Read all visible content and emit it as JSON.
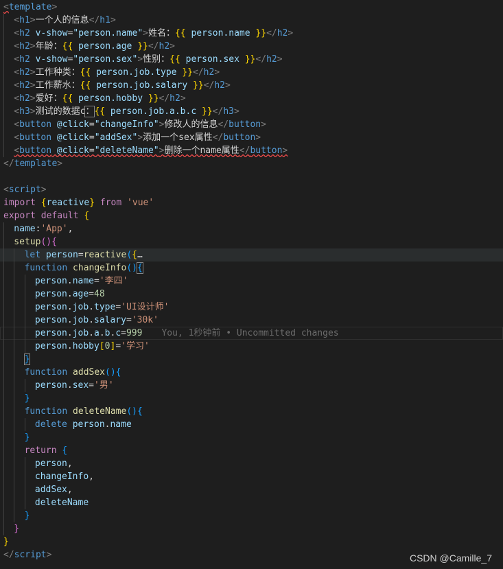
{
  "colors": {
    "background": "#1e1e1e",
    "tag_bracket": "#808080",
    "tag_name": "#569cd6",
    "attribute": "#9cdcfe",
    "string": "#ce9178",
    "keyword": "#c586c0",
    "function": "#dcdcaa",
    "number": "#b5cea8",
    "text": "#d4d4d4",
    "brace_gold": "#ffd700",
    "brace_pink": "#da70d6",
    "brace_blue": "#179fff",
    "ghost": "#6b6b6b"
  },
  "editor": {
    "lines": [
      {
        "indent": 0,
        "tokens": [
          [
            "<",
            "b"
          ],
          [
            "template",
            "t"
          ],
          [
            ">",
            "b"
          ]
        ],
        "squiggle_first": true
      },
      {
        "indent": 1,
        "tokens": [
          [
            "<",
            "b"
          ],
          [
            "h1",
            "t"
          ],
          [
            ">",
            "b"
          ],
          [
            "一个人的信息",
            "x"
          ],
          [
            "</",
            "b"
          ],
          [
            "h1",
            "t"
          ],
          [
            ">",
            "b"
          ]
        ]
      },
      {
        "indent": 1,
        "tokens": [
          [
            "<",
            "b"
          ],
          [
            "h2",
            "t"
          ],
          [
            " v-show",
            "a"
          ],
          [
            "=",
            "x"
          ],
          [
            "\"person.name\"",
            "a"
          ],
          [
            ">",
            "b"
          ],
          [
            "姓名：",
            "x"
          ],
          [
            "{{",
            "g"
          ],
          [
            " person.name ",
            "a"
          ],
          [
            "}}",
            "g"
          ],
          [
            "</",
            "b"
          ],
          [
            "h2",
            "t"
          ],
          [
            ">",
            "b"
          ]
        ]
      },
      {
        "indent": 1,
        "tokens": [
          [
            "<",
            "b"
          ],
          [
            "h2",
            "t"
          ],
          [
            ">",
            "b"
          ],
          [
            "年龄：",
            "x"
          ],
          [
            "{{",
            "g"
          ],
          [
            " person.age ",
            "a"
          ],
          [
            "}}",
            "g"
          ],
          [
            "</",
            "b"
          ],
          [
            "h2",
            "t"
          ],
          [
            ">",
            "b"
          ]
        ]
      },
      {
        "indent": 1,
        "tokens": [
          [
            "<",
            "b"
          ],
          [
            "h2",
            "t"
          ],
          [
            " v-show",
            "a"
          ],
          [
            "=",
            "x"
          ],
          [
            "\"person.sex\"",
            "a"
          ],
          [
            ">",
            "b"
          ],
          [
            "性别：",
            "x"
          ],
          [
            "{{",
            "g"
          ],
          [
            " person.sex ",
            "a"
          ],
          [
            "}}",
            "g"
          ],
          [
            "</",
            "b"
          ],
          [
            "h2",
            "t"
          ],
          [
            ">",
            "b"
          ]
        ]
      },
      {
        "indent": 1,
        "tokens": [
          [
            "<",
            "b"
          ],
          [
            "h2",
            "t"
          ],
          [
            ">",
            "b"
          ],
          [
            "工作种类：",
            "x"
          ],
          [
            "{{",
            "g"
          ],
          [
            " person.job.type ",
            "a"
          ],
          [
            "}}",
            "g"
          ],
          [
            "</",
            "b"
          ],
          [
            "h2",
            "t"
          ],
          [
            ">",
            "b"
          ]
        ]
      },
      {
        "indent": 1,
        "tokens": [
          [
            "<",
            "b"
          ],
          [
            "h2",
            "t"
          ],
          [
            ">",
            "b"
          ],
          [
            "工作薪水：",
            "x"
          ],
          [
            "{{",
            "g"
          ],
          [
            " person.job.salary ",
            "a"
          ],
          [
            "}}",
            "g"
          ],
          [
            "</",
            "b"
          ],
          [
            "h2",
            "t"
          ],
          [
            ">",
            "b"
          ]
        ]
      },
      {
        "indent": 1,
        "tokens": [
          [
            "<",
            "b"
          ],
          [
            "h2",
            "t"
          ],
          [
            ">",
            "b"
          ],
          [
            "爱好：",
            "x"
          ],
          [
            "{{",
            "g"
          ],
          [
            " person.hobby ",
            "a"
          ],
          [
            "}}",
            "g"
          ],
          [
            "</",
            "b"
          ],
          [
            "h2",
            "t"
          ],
          [
            ">",
            "b"
          ]
        ]
      },
      {
        "indent": 1,
        "tokens": [
          [
            "<",
            "b"
          ],
          [
            "h3",
            "t"
          ],
          [
            ">",
            "b"
          ],
          [
            "测试的数据c",
            "x"
          ],
          [
            "：",
            "box"
          ],
          [
            "{{",
            "g"
          ],
          [
            " person.job.a.b.c ",
            "a"
          ],
          [
            "}}",
            "g"
          ],
          [
            "</",
            "b"
          ],
          [
            "h3",
            "t"
          ],
          [
            ">",
            "b"
          ]
        ]
      },
      {
        "indent": 1,
        "tokens": [
          [
            "<",
            "b"
          ],
          [
            "button",
            "t"
          ],
          [
            " @click",
            "a"
          ],
          [
            "=",
            "x"
          ],
          [
            "\"changeInfo\"",
            "a"
          ],
          [
            ">",
            "b"
          ],
          [
            "修改人的信息",
            "x"
          ],
          [
            "</",
            "b"
          ],
          [
            "button",
            "t"
          ],
          [
            ">",
            "b"
          ]
        ]
      },
      {
        "indent": 1,
        "tokens": [
          [
            "<",
            "b"
          ],
          [
            "button",
            "t"
          ],
          [
            " @click",
            "a"
          ],
          [
            "=",
            "x"
          ],
          [
            "\"addSex\"",
            "a"
          ],
          [
            ">",
            "b"
          ],
          [
            "添加一个sex属性",
            "x"
          ],
          [
            "</",
            "b"
          ],
          [
            "button",
            "t"
          ],
          [
            ">",
            "b"
          ]
        ]
      },
      {
        "indent": 1,
        "tokens": [
          [
            "<",
            "b"
          ],
          [
            "button",
            "t"
          ],
          [
            " @click",
            "a"
          ],
          [
            "=",
            "x"
          ],
          [
            "\"deleteName\"",
            "a"
          ],
          [
            ">",
            "b"
          ],
          [
            "删除一个name属性",
            "x"
          ],
          [
            "</",
            "b"
          ],
          [
            "button",
            "t"
          ],
          [
            ">",
            "b"
          ]
        ],
        "squiggle_all": true
      },
      {
        "indent": 0,
        "tokens": [
          [
            "</",
            "b"
          ],
          [
            "template",
            "t"
          ],
          [
            ">",
            "b"
          ]
        ]
      },
      {
        "indent": 0,
        "tokens": []
      },
      {
        "indent": 0,
        "tokens": [
          [
            "<",
            "b"
          ],
          [
            "script",
            "t"
          ],
          [
            ">",
            "b"
          ]
        ]
      },
      {
        "indent": 0,
        "tokens": [
          [
            "import ",
            "k"
          ],
          [
            "{",
            "g"
          ],
          [
            "reactive",
            "a"
          ],
          [
            "}",
            "g"
          ],
          [
            " from ",
            "k"
          ],
          [
            "'vue'",
            "s"
          ]
        ]
      },
      {
        "indent": 0,
        "tokens": [
          [
            "export ",
            "k"
          ],
          [
            "default ",
            "k"
          ],
          [
            "{",
            "g"
          ]
        ]
      },
      {
        "indent": 1,
        "tokens": [
          [
            "name",
            "a"
          ],
          [
            ":",
            "x"
          ],
          [
            "'App'",
            "s"
          ],
          [
            ",",
            "x"
          ]
        ]
      },
      {
        "indent": 1,
        "tokens": [
          [
            "setup",
            "f"
          ],
          [
            "()",
            "p"
          ],
          [
            "{",
            "p"
          ]
        ]
      },
      {
        "indent": 2,
        "tokens": [
          [
            "let ",
            "t"
          ],
          [
            "person",
            "a"
          ],
          [
            "=",
            "x"
          ],
          [
            "reactive",
            "f"
          ],
          [
            "(",
            "b2"
          ],
          [
            "{",
            "g"
          ],
          [
            "…",
            "x"
          ]
        ],
        "highlight": true
      },
      {
        "indent": 2,
        "tokens": [
          [
            "function ",
            "t"
          ],
          [
            "changeInfo",
            "f"
          ],
          [
            "()",
            "b2"
          ],
          [
            "{",
            "box2"
          ]
        ]
      },
      {
        "indent": 3,
        "tokens": [
          [
            "person",
            "a"
          ],
          [
            ".",
            "x"
          ],
          [
            "name",
            "a"
          ],
          [
            "=",
            "x"
          ],
          [
            "'李四'",
            "s"
          ]
        ]
      },
      {
        "indent": 3,
        "tokens": [
          [
            "person",
            "a"
          ],
          [
            ".",
            "x"
          ],
          [
            "age",
            "a"
          ],
          [
            "=",
            "x"
          ],
          [
            "48",
            "n"
          ]
        ]
      },
      {
        "indent": 3,
        "tokens": [
          [
            "person",
            "a"
          ],
          [
            ".",
            "x"
          ],
          [
            "job",
            "a"
          ],
          [
            ".",
            "x"
          ],
          [
            "type",
            "a"
          ],
          [
            "=",
            "x"
          ],
          [
            "'UI设计师'",
            "s"
          ]
        ]
      },
      {
        "indent": 3,
        "tokens": [
          [
            "person",
            "a"
          ],
          [
            ".",
            "x"
          ],
          [
            "job",
            "a"
          ],
          [
            ".",
            "x"
          ],
          [
            "salary",
            "a"
          ],
          [
            "=",
            "x"
          ],
          [
            "'30k'",
            "s"
          ]
        ]
      },
      {
        "indent": 3,
        "tokens": [
          [
            "person",
            "a"
          ],
          [
            ".",
            "x"
          ],
          [
            "job",
            "a"
          ],
          [
            ".",
            "x"
          ],
          [
            "a",
            "a"
          ],
          [
            ".",
            "x"
          ],
          [
            "b",
            "a"
          ],
          [
            ".",
            "x"
          ],
          [
            "c",
            "a"
          ],
          [
            "=",
            "x"
          ],
          [
            "999",
            "n"
          ]
        ],
        "current": true,
        "ghost": "You, 1秒钟前 • Uncommitted changes"
      },
      {
        "indent": 3,
        "tokens": [
          [
            "person",
            "a"
          ],
          [
            ".",
            "x"
          ],
          [
            "hobby",
            "a"
          ],
          [
            "[",
            "g"
          ],
          [
            "0",
            "n"
          ],
          [
            "]",
            "g"
          ],
          [
            "=",
            "x"
          ],
          [
            "'学习'",
            "s"
          ]
        ]
      },
      {
        "indent": 2,
        "tokens": [
          [
            "}",
            "box2"
          ]
        ]
      },
      {
        "indent": 2,
        "tokens": [
          [
            "function ",
            "t"
          ],
          [
            "addSex",
            "f"
          ],
          [
            "()",
            "b2"
          ],
          [
            "{",
            "b2"
          ]
        ]
      },
      {
        "indent": 3,
        "tokens": [
          [
            "person",
            "a"
          ],
          [
            ".",
            "x"
          ],
          [
            "sex",
            "a"
          ],
          [
            "=",
            "x"
          ],
          [
            "'男'",
            "s"
          ]
        ]
      },
      {
        "indent": 2,
        "tokens": [
          [
            "}",
            "b2"
          ]
        ]
      },
      {
        "indent": 2,
        "tokens": [
          [
            "function ",
            "t"
          ],
          [
            "deleteName",
            "f"
          ],
          [
            "()",
            "b2"
          ],
          [
            "{",
            "b2"
          ]
        ]
      },
      {
        "indent": 3,
        "tokens": [
          [
            "delete ",
            "t"
          ],
          [
            "person",
            "a"
          ],
          [
            ".",
            "x"
          ],
          [
            "name",
            "a"
          ]
        ]
      },
      {
        "indent": 2,
        "tokens": [
          [
            "}",
            "b2"
          ]
        ]
      },
      {
        "indent": 2,
        "tokens": [
          [
            "return ",
            "k"
          ],
          [
            "{",
            "b2"
          ]
        ]
      },
      {
        "indent": 3,
        "tokens": [
          [
            "person",
            "a"
          ],
          [
            ",",
            "x"
          ]
        ]
      },
      {
        "indent": 3,
        "tokens": [
          [
            "changeInfo",
            "a"
          ],
          [
            ",",
            "x"
          ]
        ]
      },
      {
        "indent": 3,
        "tokens": [
          [
            "addSex",
            "a"
          ],
          [
            ",",
            "x"
          ]
        ]
      },
      {
        "indent": 3,
        "tokens": [
          [
            "deleteName",
            "a"
          ]
        ]
      },
      {
        "indent": 2,
        "tokens": [
          [
            "}",
            "b2"
          ]
        ]
      },
      {
        "indent": 1,
        "tokens": [
          [
            "}",
            "p"
          ]
        ]
      },
      {
        "indent": 0,
        "tokens": [
          [
            "}",
            "g"
          ]
        ]
      },
      {
        "indent": 0,
        "tokens": [
          [
            "</",
            "b"
          ],
          [
            "script",
            "t"
          ],
          [
            ">",
            "b"
          ]
        ]
      }
    ]
  },
  "watermark": "CSDN @Camille_7"
}
